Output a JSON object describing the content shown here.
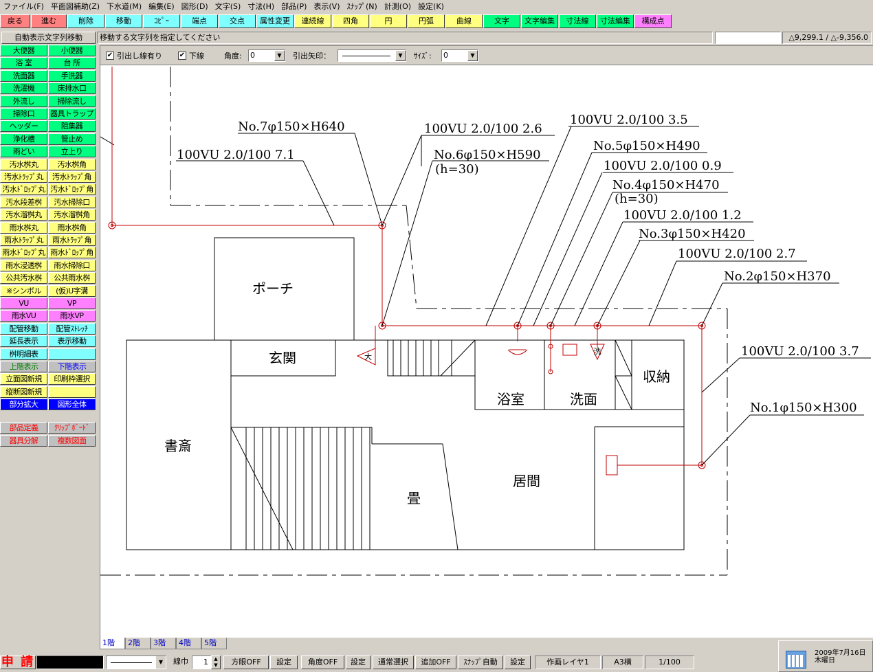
{
  "menu": [
    "ファイル(F)",
    "平面図補助(Z)",
    "下水道(M)",
    "編集(E)",
    "図形(D)",
    "文字(S)",
    "寸法(H)",
    "部品(P)",
    "表示(V)",
    "ｽﾅｯﾌﾟ(N)",
    "計測(O)",
    "設定(K)"
  ],
  "toolbar": [
    {
      "label": "戻る",
      "color": "#ff8080"
    },
    {
      "label": "進む",
      "color": "#ff8080"
    },
    {
      "label": "削除",
      "color": "#80ffff"
    },
    {
      "label": "移動",
      "color": "#80ffff"
    },
    {
      "label": "ｺﾋﾟｰ",
      "color": "#80ffff"
    },
    {
      "label": "端点",
      "color": "#80ffff"
    },
    {
      "label": "交点",
      "color": "#80ffff"
    },
    {
      "label": "属性変更",
      "color": "#80ffff"
    },
    {
      "label": "連続線",
      "color": "#ffff80"
    },
    {
      "label": "四角",
      "color": "#ffff80"
    },
    {
      "label": "円",
      "color": "#ffff80"
    },
    {
      "label": "円弧",
      "color": "#ffff80"
    },
    {
      "label": "曲線",
      "color": "#ffff80"
    },
    {
      "label": "文字",
      "color": "#00ff80"
    },
    {
      "label": "文字編集",
      "color": "#00ff80"
    },
    {
      "label": "寸法線",
      "color": "#00ff80"
    },
    {
      "label": "寸法編集",
      "color": "#00ff80"
    },
    {
      "label": "構成点",
      "color": "#ff80ff"
    }
  ],
  "status": {
    "mode": "自動表示文字列移動",
    "message": "移動する文字列を指定してください",
    "coords": "△9,299.1 / △-9,356.0"
  },
  "side": [
    [
      "大便器",
      "小便器",
      "#00ff80"
    ],
    [
      "浴 室",
      "台 所",
      "#00ff80"
    ],
    [
      "洗面器",
      "手洗器",
      "#00ff80"
    ],
    [
      "洗濯機",
      "床排水口",
      "#00ff80"
    ],
    [
      "外流し",
      "掃除流し",
      "#00ff80"
    ],
    [
      "掃除口",
      "器具トラップ",
      "#00ff80"
    ],
    [
      "ヘッダー",
      "阻集器",
      "#00ff80"
    ],
    [
      "浄化槽",
      "管止め",
      "#00ff80"
    ],
    [
      "雨どい",
      "立上り",
      "#00ff80"
    ],
    [
      "汚水桝丸",
      "汚水桝角",
      "#ffff80"
    ],
    [
      "汚水ﾄﾗｯﾌﾟ丸",
      "汚水ﾄﾗｯﾌﾟ角",
      "#ffff80"
    ],
    [
      "汚水ﾄﾞﾛｯﾌﾟ丸",
      "汚水ﾄﾞﾛｯﾌﾟ角",
      "#ffff80"
    ],
    [
      "汚水段差桝",
      "汚水掃除口",
      "#ffff80"
    ],
    [
      "汚水溜桝丸",
      "汚水溜桝角",
      "#ffff80"
    ],
    [
      "雨水桝丸",
      "雨水桝角",
      "#ffff80"
    ],
    [
      "雨水ﾄﾗｯﾌﾟ丸",
      "雨水ﾄﾗｯﾌﾟ角",
      "#ffff80"
    ],
    [
      "雨水ﾄﾞﾛｯﾌﾟ丸",
      "雨水ﾄﾞﾛｯﾌﾟ角",
      "#ffff80"
    ],
    [
      "雨水浸透桝",
      "雨水掃除口",
      "#ffff80"
    ],
    [
      "公共汚水桝",
      "公共雨水桝",
      "#ffff80"
    ],
    [
      "※シンボル",
      "(仮)U字溝",
      "#ffff80"
    ],
    [
      "VU",
      "VP",
      "#ff80ff"
    ],
    [
      "雨水VU",
      "雨水VP",
      "#ff80ff"
    ],
    [
      "配管移動",
      "配管ｽﾄﾚｯﾁ",
      "#80ffff"
    ],
    [
      "延長表示",
      "表示移動",
      "#80ffff"
    ],
    [
      "桝明細表",
      "",
      "#80ffff"
    ],
    [
      "上階表示",
      "下階表示",
      "#c0c0c0"
    ],
    [
      "立面図新規",
      "印刷枠選択",
      "#ffff80"
    ],
    [
      "縦断図新規",
      "",
      "#ffff80"
    ],
    [
      "部分拡大",
      "図形全体",
      "#0000ff"
    ]
  ],
  "side_bottom": [
    [
      "部品定義",
      "ｸﾘｯﾌﾟﾎﾞｰﾄﾞ"
    ],
    [
      "器具分解",
      "複数図面"
    ]
  ],
  "options": {
    "leader": "引出し線有り",
    "underline": "下線",
    "angle_label": "角度:",
    "angle": "0",
    "arrow_label": "引出矢印：",
    "size_label": "ｻｲｽﾞ:",
    "size": "0"
  },
  "drawing": {
    "rooms": [
      "ポーチ",
      "玄関",
      "浴室",
      "洗面",
      "収納",
      "書斎",
      "畳",
      "居間"
    ],
    "labels": [
      "No.7φ150×H640",
      "100VU 2.0/100 7.1",
      "100VU 2.0/100 2.6",
      "No.6φ150×H590",
      "(h=30)",
      "100VU 2.0/100 3.5",
      "No.5φ150×H490",
      "100VU 2.0/100 0.9",
      "No.4φ150×H470",
      "(h=30)",
      "100VU 2.0/100 1.2",
      "No.3φ150×H420",
      "100VU 2.0/100 2.7",
      "No.2φ150×H370",
      "100VU 2.0/100 3.7",
      "No.1φ150×H300"
    ],
    "fixtures": [
      "大",
      "洗"
    ]
  },
  "tabs": [
    "1階",
    "2階",
    "3階",
    "4階",
    "5階"
  ],
  "bottom": {
    "apply": "申 請",
    "linewidth_label": "線巾",
    "linewidth": "1",
    "macho": "方眼OFF",
    "set1": "設定",
    "angle": "角度OFF",
    "set2": "設定",
    "select": "通常選択",
    "add": "追加OFF",
    "snap": "ｽﾅｯﾌﾟ自動",
    "set3": "設定",
    "layer": "作画レイヤ1",
    "paper": "A3横",
    "scale": "1/100",
    "date": "2009年7月16日",
    "weekday": "木曜日"
  }
}
